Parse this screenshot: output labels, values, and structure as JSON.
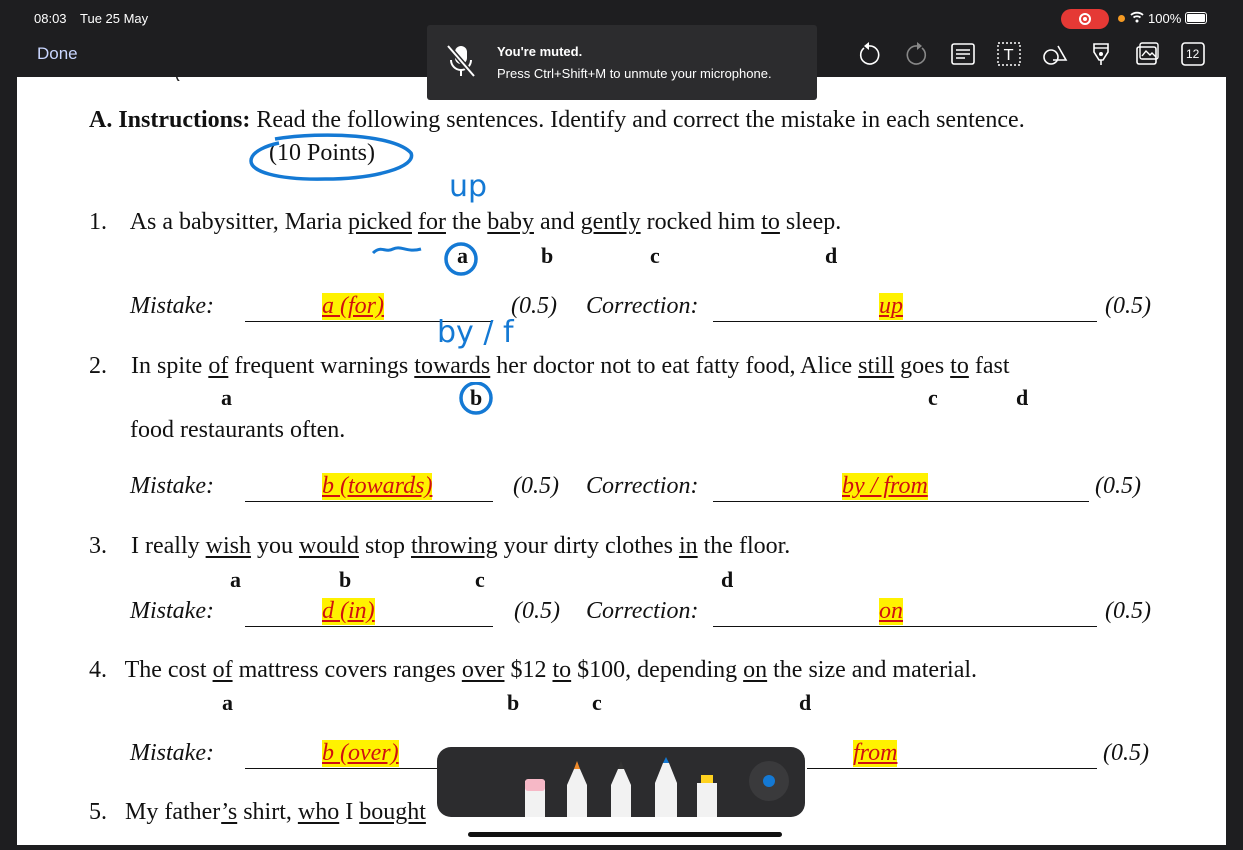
{
  "status_bar": {
    "time": "08:03",
    "date": "Tue 25 May",
    "battery": "100%"
  },
  "nav": {
    "done_label": "Done",
    "page_count": "12"
  },
  "toast": {
    "title": "You're muted.",
    "message": "Press Ctrl+Shift+M to unmute your microphone."
  },
  "toolbar": {
    "icons": [
      "undo-icon",
      "redo-icon",
      "text-recognition-icon",
      "text-box-icon",
      "shapes-icon",
      "highlighter-pen-icon",
      "image-icon",
      "page-count-icon"
    ]
  },
  "document": {
    "instructions_label": "A. Instructions:",
    "instructions_text": "Read the following sentences. Identify and correct the mistake in each sentence.",
    "points": "(10 Points)",
    "mistake_label": "Mistake:",
    "correction_label": "Correction:",
    "score": "(0.5)",
    "q1": {
      "num": "1.",
      "p1": "As a babysitter, Maria ",
      "picked": "picked",
      "s1": " ",
      "for": "for",
      "s2": " the ",
      "baby": "baby",
      "s3": " and ",
      "gently": "gently",
      "s4": " rocked him ",
      "to": "to",
      "s5": " sleep.",
      "letters": [
        "a",
        "b",
        "c",
        "d"
      ],
      "mistake": "a (for)",
      "correction": "up",
      "ink_note": "up"
    },
    "q2": {
      "num": "2.",
      "p1": "In spite ",
      "of": "of",
      "s1": " frequent warnings ",
      "towards": "towards",
      "s2": " her doctor not to eat fatty food, Alice ",
      "still": "still",
      "s3": " goes ",
      "to": "to",
      "s4": " fast",
      "line2": "food restaurants often.",
      "letters": [
        "a",
        "b",
        "c",
        "d"
      ],
      "mistake": "b (towards)",
      "correction": "by / from",
      "ink_note": "by / f"
    },
    "q3": {
      "num": "3.",
      "p1": "I really ",
      "wish": "wish",
      "s1": " you ",
      "would": "would",
      "s2": " stop ",
      "throwing": "throwing",
      "s3": " your dirty clothes ",
      "in": "in",
      "s4": " the floor.",
      "letters": [
        "a",
        "b",
        "c",
        "d"
      ],
      "mistake": "d (in)",
      "correction": "on"
    },
    "q4": {
      "num": "4.",
      "p1": "The cost ",
      "of": "of",
      "s1": " mattress covers ranges ",
      "over": "over",
      "s2": " $12 ",
      "to": "to",
      "s3": " $100, depending ",
      "on": "on",
      "s4": " the size and material.",
      "letters": [
        "a",
        "b",
        "c",
        "d"
      ],
      "mistake": "b (over)",
      "correction": "from"
    },
    "q5": {
      "num": "5.",
      "p1": "My father",
      "apos_s": "’s",
      "s1": " shirt, ",
      "who": "who",
      "s2": " I ",
      "bought": "bought"
    }
  },
  "colors": {
    "ink": "#1479d4",
    "answer_text": "#d01010",
    "highlight": "#fff200",
    "toast_bg": "#2c2c2e"
  }
}
